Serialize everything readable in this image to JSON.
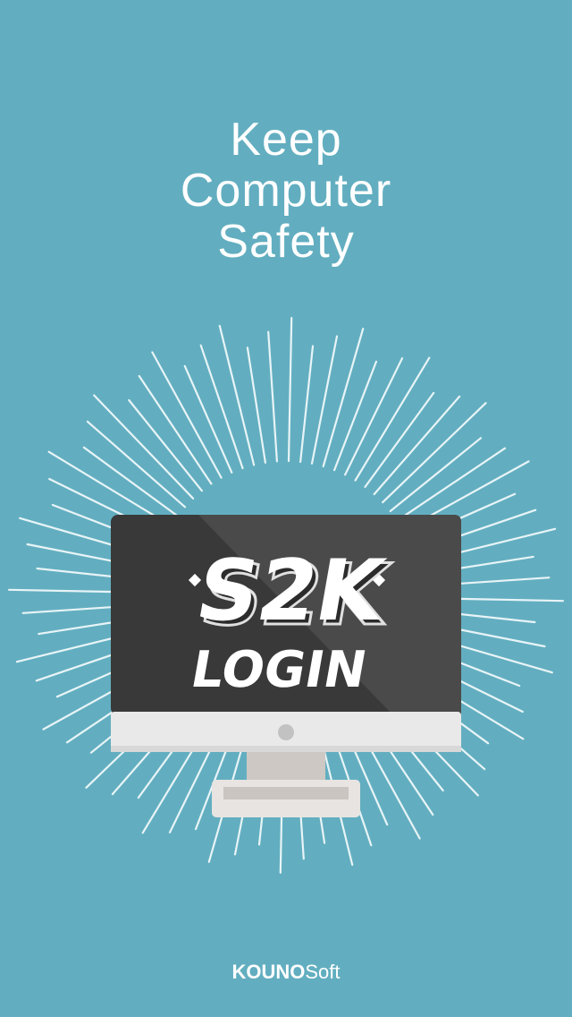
{
  "colors": {
    "background": "#62aec0",
    "screen_dark": "#3a3a3a",
    "bezel": "#e9e9e9",
    "stand": "#cfcac6",
    "text": "#ffffff"
  },
  "tagline": {
    "line1": "Keep",
    "line2": "Computer",
    "line3": "Safety"
  },
  "logo": {
    "line1": "S2K",
    "line2": "LOGIN"
  },
  "footer": {
    "brand_bold": "KOUNO",
    "brand_regular": "Soft"
  }
}
